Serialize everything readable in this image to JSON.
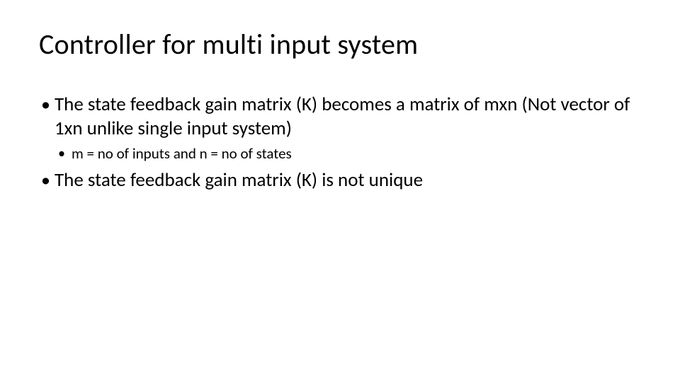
{
  "title": "Controller for multi input system",
  "bullets": {
    "item1": "The state feedback gain matrix (K) becomes a matrix of mxn (Not vector of 1xn unlike single input system)",
    "sub1": "m = no of inputs and n = no of states",
    "item2": "The state feedback gain matrix (K) is not unique"
  }
}
